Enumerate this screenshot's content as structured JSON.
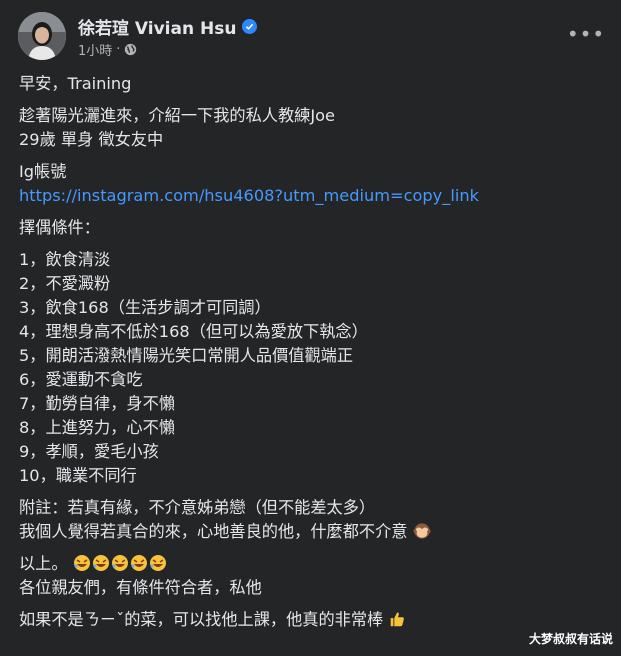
{
  "post": {
    "author": "徐若瑄 Vivian Hsu",
    "time": "1小時",
    "separator": "·",
    "more_label": "•••",
    "verified_color": "#2d88ff",
    "link_color": "#4599ff"
  },
  "body": {
    "greeting": "早安，Training",
    "intro": [
      "趁著陽光灑進來，介紹一下我的私人教練Joe",
      "29歲 單身 徵女友中"
    ],
    "ig_label": "Ig帳號",
    "ig_link": "https://instagram.com/hsu4608?utm_medium=copy_link",
    "conditions_title": "擇偶條件：",
    "conditions": [
      "1，飲食清淡",
      "2，不愛澱粉",
      "3，飲食168（生活步調才可同調）",
      "4，理想身高不低於168（但可以為愛放下執念）",
      "5，開朗活潑熱情陽光笑口常開人品價值觀端正",
      "6，愛運動不貪吃",
      "7，勤勞自律，身不懶",
      "8，上進努力，心不懶",
      "9，孝順，愛毛小孩",
      "10，職業不同行"
    ],
    "note": [
      "附註：若真有緣，不介意姊弟戀（但不能差太多）",
      "我個人覺得若真合的來，心地善良的他，什麼都不介意"
    ],
    "closing": "以上。",
    "call": "各位親友們，有條件符合者，私他",
    "final": "如果不是ㄋㄧˇ的菜，可以找他上課，他真的非常棒"
  },
  "icons": {
    "avatar": "profile-photo",
    "verified": "verified-badge-icon",
    "globe": "globe-icon",
    "monkey": "see-no-evil-monkey-emoji",
    "laughing": "rolling-laughing-emoji",
    "thumbs": "thumbs-up-emoji"
  },
  "watermark": "大梦叔叔有话说"
}
